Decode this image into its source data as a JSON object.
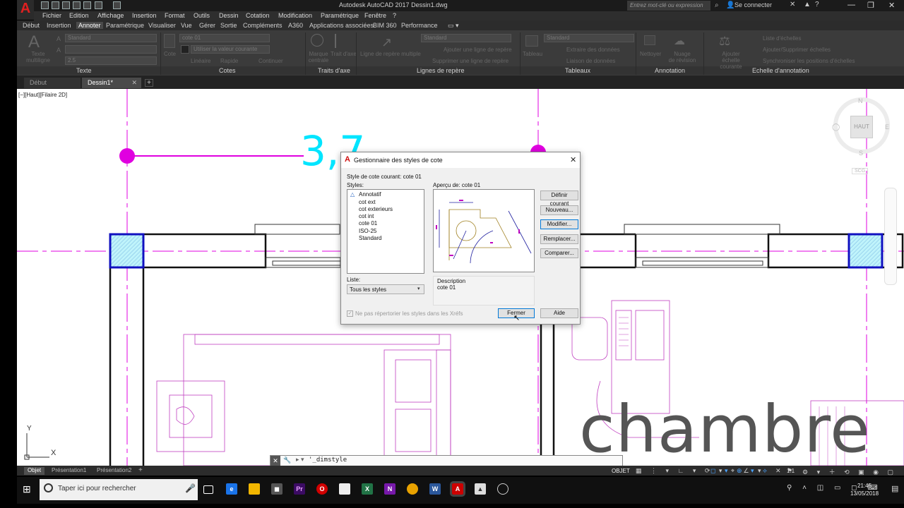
{
  "app": {
    "title": "Autodesk AutoCAD 2017   Dessin1.dwg",
    "search_placeholder": "Entrez mot-clé ou expression",
    "signin": "Se connecter",
    "help": "?"
  },
  "menus": [
    "Fichier",
    "Edition",
    "Affichage",
    "Insertion",
    "Format",
    "Outils",
    "Dessin",
    "Cotation",
    "Modification",
    "Paramétrique",
    "Fenêtre",
    "?"
  ],
  "ribbon_tabs": [
    "Début",
    "Insertion",
    "Annoter",
    "Paramétrique",
    "Visualiser",
    "Vue",
    "Gérer",
    "Sortie",
    "Compléments",
    "A360",
    "Applications associées",
    "BIM 360",
    "Performance"
  ],
  "active_ribbon_tab": "Annoter",
  "ribbon": {
    "text": {
      "panel": "Texte",
      "multiline": "Texte\nmultiligne",
      "style": "Standard",
      "height": "2.5"
    },
    "dimensions": {
      "panel": "Cotes",
      "button": "Cote",
      "style": "cote 01",
      "layer": "Utiliser la valeur courante",
      "linear": "Linéaire",
      "quick": "Rapide",
      "continue": "Continuer"
    },
    "centerlines": {
      "panel": "Traits d'axe",
      "center_mark": "Marque\ncentrale",
      "centerline": "Trait d'axe"
    },
    "leaders": {
      "panel": "Lignes de repère",
      "multileader": "Ligne de repère multiple",
      "style": "Standard",
      "add": "Ajouter une ligne de repère",
      "remove": "Supprimer une ligne de repère"
    },
    "tables": {
      "panel": "Tableaux",
      "button": "Tableau",
      "style": "Standard",
      "extract": "Extraire des données",
      "link": "Liaison de données"
    },
    "annotation": {
      "panel": "Annotation",
      "wipeout": "Nettoyer",
      "revcloud": "Nuage\nde révision"
    },
    "scale": {
      "panel": "Echelle d'annotation",
      "add_current": "Ajouter\néchelle courante",
      "list": "Liste d'échelles",
      "add_remove": "Ajouter/Supprimer échelles",
      "sync": "Synchroniser les positions d'échelles"
    }
  },
  "doc_tabs": [
    {
      "label": "Début",
      "active": false
    },
    {
      "label": "Dessin1*",
      "active": true
    }
  ],
  "viewport_label": "[−][Haut][Filaire 2D]",
  "drawing": {
    "dimension_text": "3,7",
    "room_label": "chambre"
  },
  "viewcube": {
    "top": "HAUT",
    "north": "N",
    "south": "S",
    "east": "E",
    "wcs": "SCG"
  },
  "ucs": {
    "x": "X",
    "y": "Y"
  },
  "dialog": {
    "title": "Gestionnaire des styles de cote",
    "current_style": "Style de cote courant: cote 01",
    "styles_label": "Styles:",
    "styles": [
      "Annotatif",
      "cot ext",
      "cot exterieurs",
      "cot int",
      "cote 01",
      "ISO-25",
      "Standard"
    ],
    "preview_label": "Aperçu de: cote 01",
    "buttons": {
      "set_current": "Définir courant",
      "new": "Nouveau...",
      "modify": "Modifier...",
      "override": "Remplacer...",
      "compare": "Comparer...",
      "close": "Fermer",
      "help": "Aide"
    },
    "list_label": "Liste:",
    "list_value": "Tous les styles",
    "xref_checkbox": "Ne pas répertorier les styles dans les Xréfs",
    "description_label": "Description",
    "description_value": "cote 01"
  },
  "command_line": "'_dimstyle",
  "layout_tabs": [
    {
      "label": "Objet",
      "active": true
    },
    {
      "label": "Présentation1",
      "active": false
    },
    {
      "label": "Présentation2",
      "active": false
    }
  ],
  "status": {
    "model": "OBJET",
    "scale": "1:1"
  },
  "taskbar": {
    "search": "Taper ici pour rechercher",
    "time": "21:45",
    "date": "13/05/2018"
  },
  "colors": {
    "magenta": "#e000e0",
    "cyan_dim": "#00e5ff",
    "hatch": "#b8f0f8",
    "dark_ui": "#3b3b3b",
    "autocad_red": "#e02020"
  }
}
